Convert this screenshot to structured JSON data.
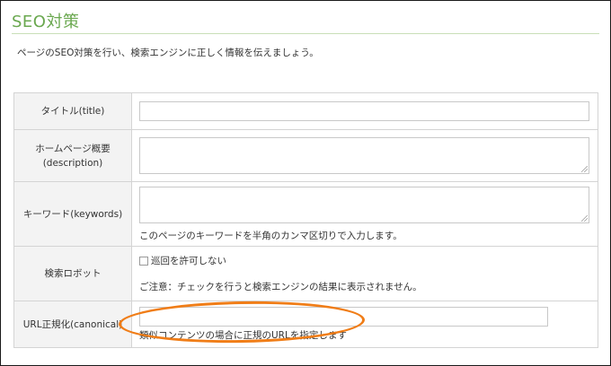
{
  "section": {
    "title": "SEO対策",
    "intro": "ページのSEO対策を行い、検索エンジンに正しく情報を伝えましょう。"
  },
  "form": {
    "title_label": "タイトル(title)",
    "title_value": "",
    "description_label_line1": "ホームページ概要",
    "description_label_line2": "(description)",
    "description_value": "",
    "keywords_label": "キーワード(keywords)",
    "keywords_value": "",
    "keywords_note": "このページのキーワードを半角のカンマ区切りで入力します。",
    "robot_label": "検索ロボット",
    "robot_checkbox_label": "巡回を許可しない",
    "robot_checkbox_checked": false,
    "robot_note": "ご注意：チェックを行うと検索エンジンの結果に表示されません。",
    "canonical_label": "URL正規化(canonical)",
    "canonical_value": "",
    "canonical_note": "類似コンテンツの場合に正規のURLを指定します"
  },
  "colors": {
    "title": "#6aa84f",
    "annotation": "#f07d17",
    "label_bg": "#f3f3f3"
  }
}
